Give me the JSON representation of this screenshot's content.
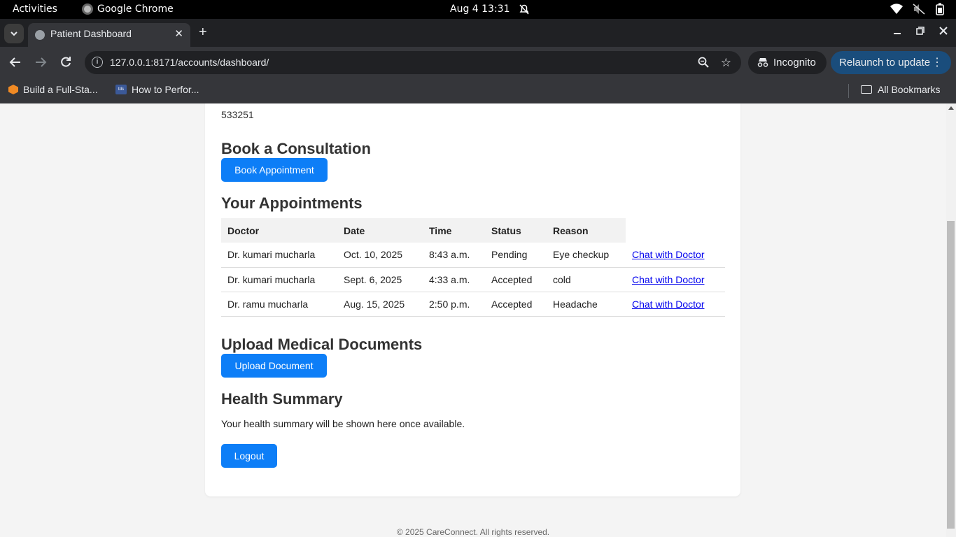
{
  "os_bar": {
    "activities": "Activities",
    "app_name": "Google Chrome",
    "datetime": "Aug 4  13:31"
  },
  "browser": {
    "tab_title": "Patient Dashboard",
    "url": "127.0.0.1:8171/accounts/dashboard/",
    "incognito_label": "Incognito",
    "relaunch_label": "Relaunch to update",
    "bookmarks": [
      {
        "label": "Build a Full-Sta..."
      },
      {
        "label": "How to Perfor..."
      }
    ],
    "all_bookmarks_label": "All Bookmarks"
  },
  "page": {
    "pincode": "533251",
    "book_heading": "Book a Consultation",
    "book_button": "Book Appointment",
    "appointments_heading": "Your Appointments",
    "table": {
      "headers": [
        "Doctor",
        "Date",
        "Time",
        "Status",
        "Reason"
      ],
      "rows": [
        {
          "doctor": "Dr. kumari mucharla",
          "date": "Oct. 10, 2025",
          "time": "8:43 a.m.",
          "status": "Pending",
          "reason": "Eye checkup",
          "action": "Chat with Doctor"
        },
        {
          "doctor": "Dr. kumari mucharla",
          "date": "Sept. 6, 2025",
          "time": "4:33 a.m.",
          "status": "Accepted",
          "reason": "cold",
          "action": "Chat with Doctor"
        },
        {
          "doctor": "Dr. ramu mucharla",
          "date": "Aug. 15, 2025",
          "time": "2:50 p.m.",
          "status": "Accepted",
          "reason": "Headache",
          "action": "Chat with Doctor"
        }
      ]
    },
    "upload_heading": "Upload Medical Documents",
    "upload_button": "Upload Document",
    "health_heading": "Health Summary",
    "health_text": "Your health summary will be shown here once available.",
    "logout_button": "Logout",
    "footer": "© 2025 CareConnect. All rights reserved."
  },
  "colors": {
    "primary_button": "#0d7ef7",
    "link": "#0000ee",
    "chrome_dark": "#202124",
    "chrome_toolbar": "#35363a"
  }
}
